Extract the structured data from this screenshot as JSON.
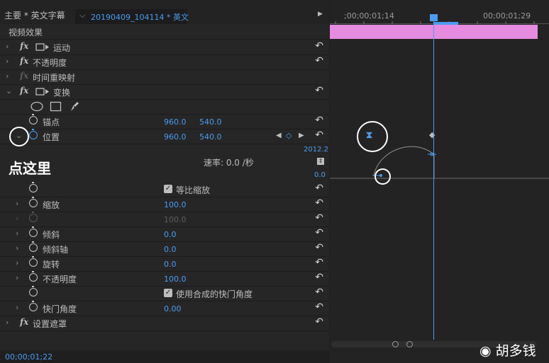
{
  "header": {
    "tab_main": "主要 * 英文字幕",
    "tab_clip": "20190409_104114 * 英文",
    "chevron_icon": "chevron-down-icon",
    "play_icon": "play-right-icon"
  },
  "panel": {
    "section_title": "视频效果",
    "effects": [
      {
        "label": "运动"
      },
      {
        "label": "不透明度"
      },
      {
        "label": "时间重映射"
      },
      {
        "label": "变换"
      }
    ],
    "fx_label": "fx",
    "anchor": {
      "label": "锚点",
      "x": "960.0",
      "y": "540.0"
    },
    "position": {
      "label": "位置",
      "x": "960.0",
      "y": "540.0"
    },
    "graph_max": "2012.2",
    "graph_min": "0.0",
    "speed_label": "速率: 0.0 /秒",
    "uniform_scale": "等比缩放",
    "scale": {
      "label": "缩放",
      "value": "100.0"
    },
    "scale_dim": {
      "value": "100.0"
    },
    "skew": {
      "label": "倾斜",
      "value": "0.0"
    },
    "skew_axis": {
      "label": "倾斜轴",
      "value": "0.0"
    },
    "rotation": {
      "label": "旋转",
      "value": "0.0"
    },
    "opacity": {
      "label": "不透明度",
      "value": "100.0"
    },
    "composite_shutter": "使用合成的快门角度",
    "shutter_angle": {
      "label": "快门角度",
      "value": "0.00"
    },
    "mask": {
      "label": "设置遮罩"
    }
  },
  "annotation": {
    "click_here": "点这里"
  },
  "timeline": {
    "time_left": ";00;00;01;14",
    "time_right": "00;00;01;29"
  },
  "footer": {
    "current_time": "00;00;01;22"
  },
  "watermark": {
    "text": "胡多钱"
  },
  "colors": {
    "accent": "#4a9cf0",
    "clip": "#e58be0"
  }
}
